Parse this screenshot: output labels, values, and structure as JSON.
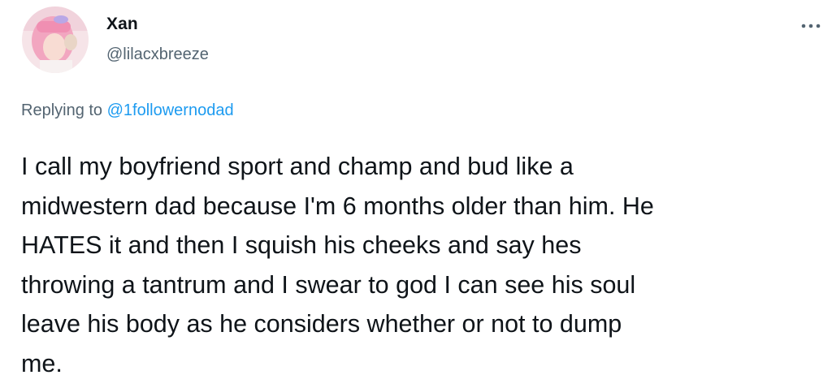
{
  "author": {
    "display_name": "Xan",
    "handle": "@lilacxbreeze",
    "avatar_icon": "profile-photo-icon"
  },
  "more_icon": "more-horizontal-icon",
  "reply": {
    "prefix": "Replying to",
    "target": "@1followernodad"
  },
  "tweet": {
    "lines": [
      "I call my boyfriend sport and champ and bud like a",
      "midwestern dad because I'm 6 months older than him. He",
      "HATES it and then I squish his cheeks and say hes",
      "throwing a tantrum and I swear to god I can see his soul",
      "leave his body as he considers whether or not to dump",
      "me."
    ]
  },
  "colors": {
    "text": "#0f1419",
    "secondary": "#536471",
    "link": "#1d9bf0",
    "avatar_pink": "#f4a7c3"
  }
}
